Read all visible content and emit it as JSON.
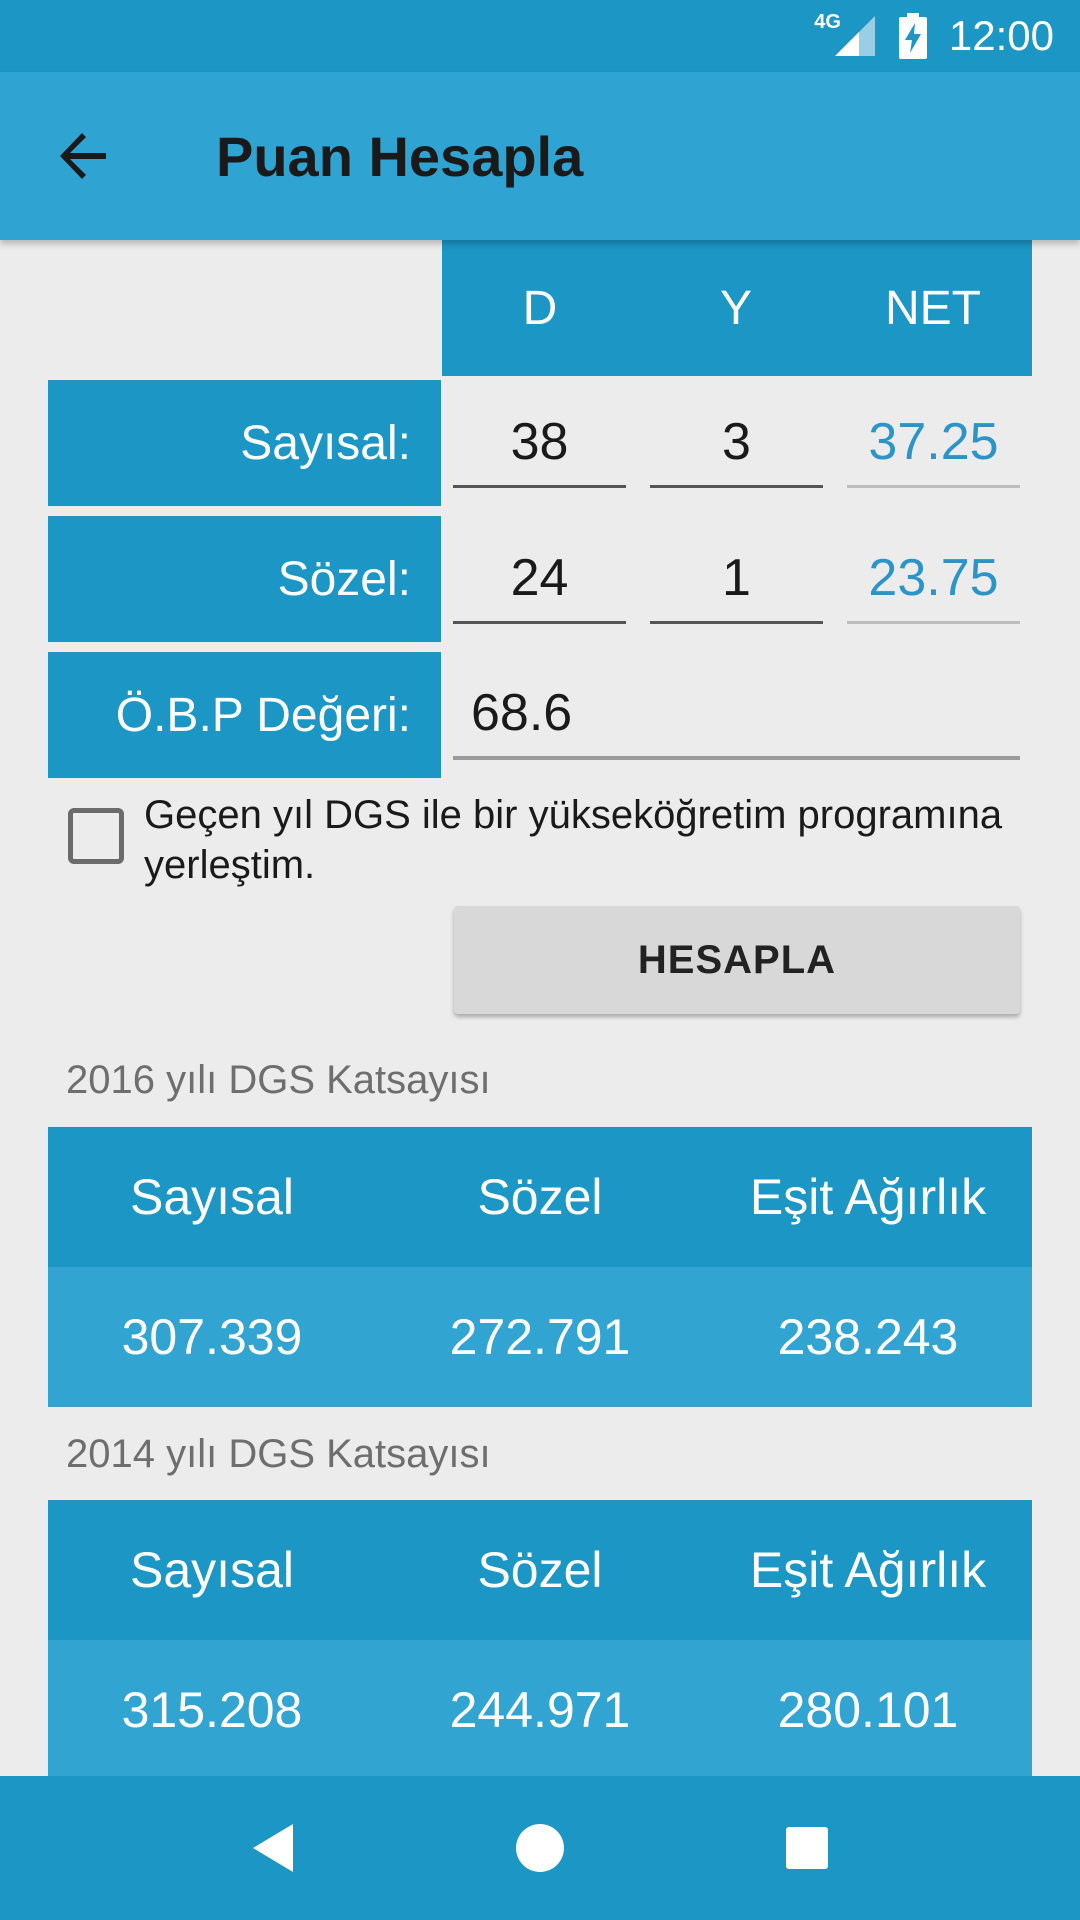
{
  "status_bar": {
    "network": "4G",
    "time": "12:00"
  },
  "app_bar": {
    "title": "Puan Hesapla"
  },
  "score_table": {
    "headers": [
      "D",
      "Y",
      "NET"
    ],
    "rows": [
      {
        "label": "Sayısal:",
        "d": "38",
        "y": "3",
        "net": "37.25"
      },
      {
        "label": "Sözel:",
        "d": "24",
        "y": "1",
        "net": "23.75"
      }
    ],
    "obp": {
      "label": "Ö.B.P Değeri:",
      "value": "68.6"
    }
  },
  "checkbox": {
    "label": "Geçen yıl DGS ile bir yükseköğretim programına yerleştim.",
    "checked": false
  },
  "button": {
    "label": "HESAPLA"
  },
  "coefficients": [
    {
      "title": "2016 yılı DGS Katsayısı",
      "headers": [
        "Sayısal",
        "Sözel",
        "Eşit Ağırlık"
      ],
      "values": [
        "307.339",
        "272.791",
        "238.243"
      ]
    },
    {
      "title": "2014 yılı DGS Katsayısı",
      "headers": [
        "Sayısal",
        "Sözel",
        "Eşit Ağırlık"
      ],
      "values": [
        "315.208",
        "244.971",
        "280.101"
      ]
    }
  ],
  "colors": {
    "primary_dark": "#1b96c5",
    "primary": "#2fa3d1",
    "net_text": "#2a95c6",
    "background": "#ececec"
  },
  "icons": {
    "back": "arrow-left-icon",
    "nav_back": "triangle-back-icon",
    "nav_home": "circle-home-icon",
    "nav_recents": "square-recents-icon"
  }
}
